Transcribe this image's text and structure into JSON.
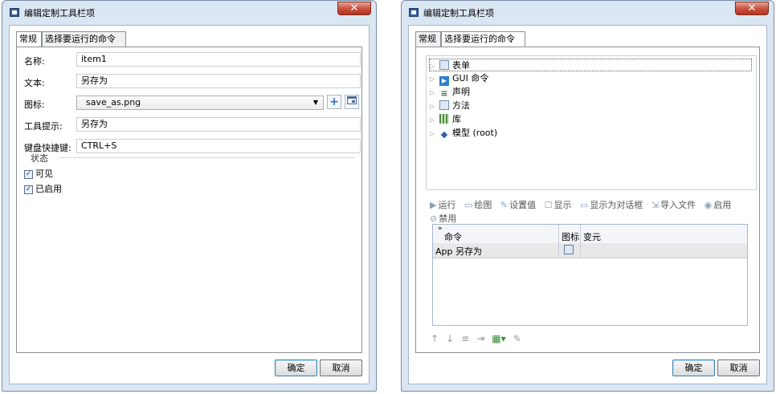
{
  "dialog1": {
    "title": "编辑定制工具栏项",
    "close": "✕",
    "tabs": [
      "常规",
      "选择要运行的命令"
    ],
    "fields": {
      "name_label": "名称:",
      "name_value": "item1",
      "text_label": "文本:",
      "text_value": "另存为",
      "icon_label": "图标:",
      "icon_value": "save_as.png",
      "tooltip_label": "工具提示:",
      "tooltip_value": "另存为",
      "shortcut_label": "键盘快捷键:",
      "shortcut_value": "CTRL+S"
    },
    "state_section": "状态",
    "checks": [
      {
        "label": "可见",
        "checked": true
      },
      {
        "label": "已启用",
        "checked": true
      }
    ],
    "buttons": {
      "ok": "确定",
      "cancel": "取消"
    }
  },
  "dialog2": {
    "title": "编辑定制工具栏项",
    "close": "✕",
    "tabs": [
      "常规",
      "选择要运行的命令"
    ],
    "tree": [
      {
        "label": "表单",
        "icon": "forms-icon",
        "color": "#6e8fb8"
      },
      {
        "label": "GUI 命令",
        "icon": "gui-command-icon",
        "color": "#2d7fd0"
      },
      {
        "label": "声明",
        "icon": "declarations-icon",
        "color": "#3a7a3a"
      },
      {
        "label": "方法",
        "icon": "methods-icon",
        "color": "#6e8fb8"
      },
      {
        "label": "库",
        "icon": "library-icon",
        "color": "#4e8b3a"
      },
      {
        "label": "模型 (root)",
        "icon": "model-icon",
        "color": "#2f5f9e"
      }
    ],
    "toolbar": {
      "run": "运行",
      "plot": "绘图",
      "set_value": "设置值",
      "show": "显示",
      "show_dialog": "显示为对话框",
      "import_file": "导入文件",
      "enable": "启用",
      "disable": "禁用"
    },
    "grid": {
      "columns": [
        "命令",
        "图标",
        "变元"
      ],
      "rows": [
        {
          "command": "App 另存为",
          "icon": "save-as-icon",
          "args": ""
        }
      ]
    },
    "buttons": {
      "ok": "确定",
      "cancel": "取消"
    }
  }
}
